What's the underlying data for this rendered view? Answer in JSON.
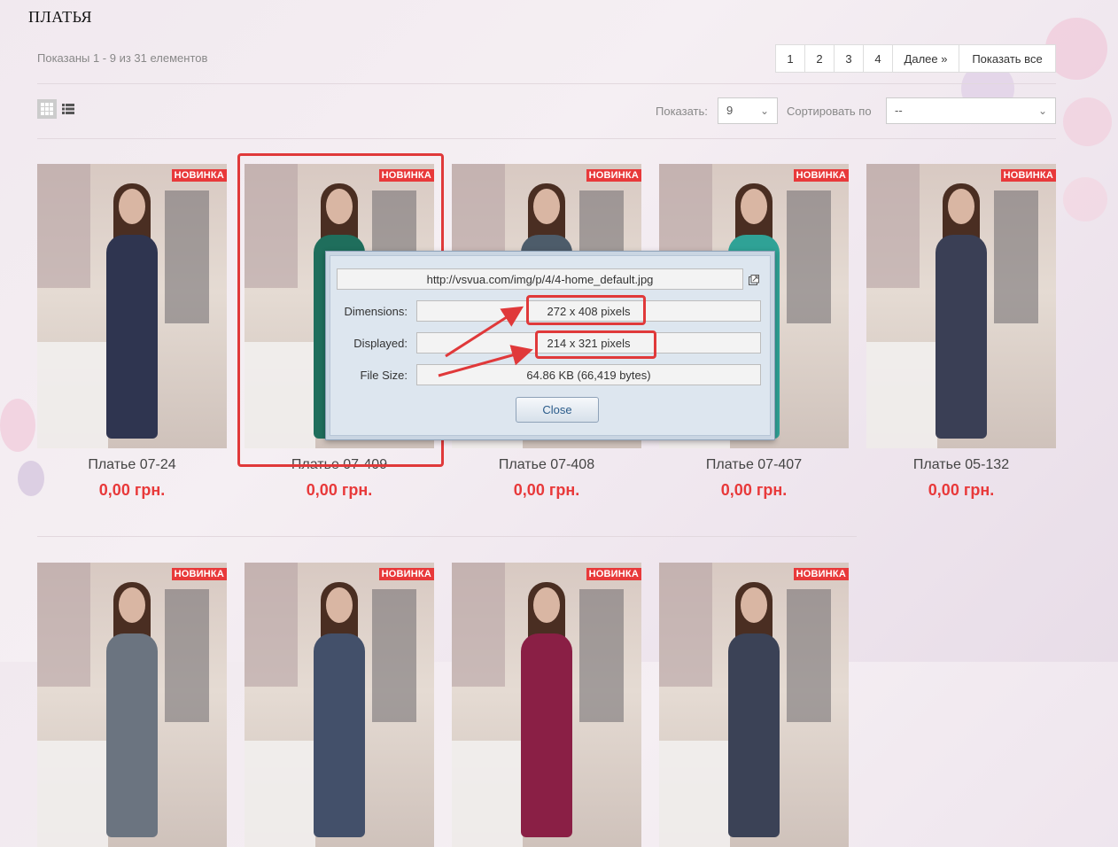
{
  "page": {
    "title": "ПЛАТЬЯ",
    "count_text": "Показаны 1 - 9 из 31 елементов"
  },
  "pagination": [
    "1",
    "2",
    "3",
    "4",
    "Далее »",
    "Показать все"
  ],
  "toolbar": {
    "show_label": "Показать:",
    "show_value": "9",
    "sort_label": "Сортировать по",
    "sort_value": "--"
  },
  "products": [
    {
      "name": "Платье 07-24",
      "price": "0,00 грн.",
      "badge": "НОВИНКА",
      "dress_color": "#2f3550"
    },
    {
      "name": "Платье 07-409",
      "price": "0,00 грн.",
      "badge": "НОВИНКА",
      "dress_color": "#1f6e5c"
    },
    {
      "name": "Платье 07-408",
      "price": "0,00 грн.",
      "badge": "НОВИНКА",
      "dress_color": "#4d5c6a"
    },
    {
      "name": "Платье 07-407",
      "price": "0,00 грн.",
      "badge": "НОВИНКА",
      "dress_color": "#2fa296"
    },
    {
      "name": "Платье 05-132",
      "price": "0,00 грн.",
      "badge": "НОВИНКА",
      "dress_color": "#3a3f55"
    }
  ],
  "products_row2": [
    {
      "badge": "НОВИНКА",
      "dress_color": "#6b7480"
    },
    {
      "badge": "НОВИНКА",
      "dress_color": "#43506a"
    },
    {
      "badge": "НОВИНКА",
      "dress_color": "#8a1f45"
    },
    {
      "badge": "НОВИНКА",
      "dress_color": "#3b4256"
    }
  ],
  "image_dialog": {
    "url": "http://vsvua.com/img/p/4/4-home_default.jpg",
    "dimensions_label": "Dimensions:",
    "dimensions_value": "272 x 408 pixels",
    "displayed_label": "Displayed:",
    "displayed_value": "214 x 321 pixels",
    "filesize_label": "File Size:",
    "filesize_value": "64.86 KB (66,419 bytes)",
    "close_label": "Close"
  },
  "colors": {
    "accent_red": "#e8393a",
    "annotation_red": "#e0393a"
  }
}
